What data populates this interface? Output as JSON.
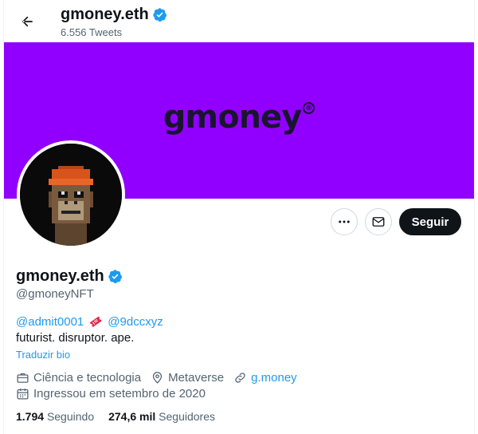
{
  "header": {
    "name": "gmoney.eth",
    "tweet_count": "6.556 Tweets"
  },
  "banner": {
    "logo_text": "gmoney",
    "logo_mark": "®",
    "bg_color": "#9100ff"
  },
  "profile": {
    "display_name": "gmoney.eth",
    "handle": "@gmoneyNFT",
    "verified": true,
    "bio_mention_1": "@admit0001",
    "bio_emoji": "ticket-icon",
    "bio_mention_2": "@9dccxyz",
    "bio_text": "futurist. disruptor. ape.",
    "translate_label": "Traduzir bio",
    "category": "Ciência e tecnologia",
    "location": "Metaverse",
    "website": "g.money",
    "joined": "Ingressou em setembro de 2020",
    "following_count": "1.794",
    "following_label": "Seguindo",
    "followers_count": "274,6 mil",
    "followers_label": "Seguidores"
  },
  "actions": {
    "follow_label": "Seguir",
    "more_icon": "more-icon",
    "message_icon": "mail-icon"
  },
  "colors": {
    "accent": "#1d9bf0",
    "text": "#0f1419",
    "secondary": "#536471"
  }
}
